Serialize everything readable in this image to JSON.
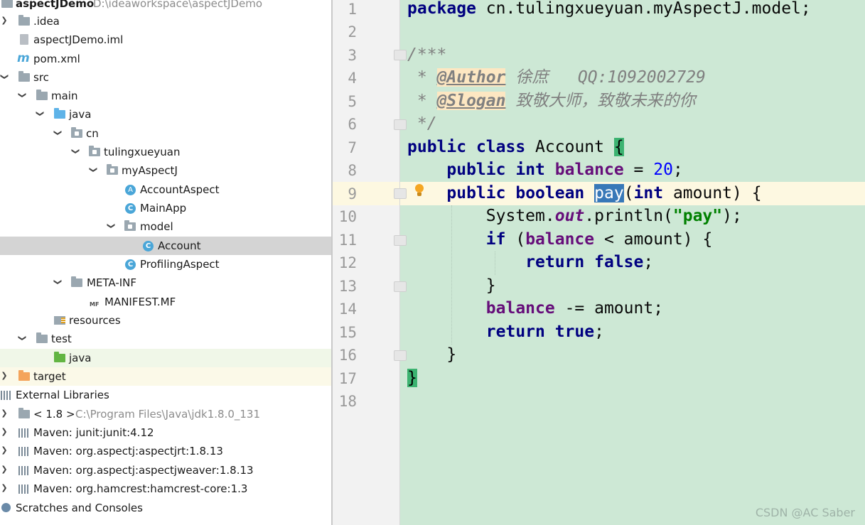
{
  "project": {
    "root_name": "aspectJDemo",
    "root_path": "D:\\ideaworkspace\\aspectJDemo",
    "items": [
      {
        "label": ".idea"
      },
      {
        "label": "aspectJDemo.iml"
      },
      {
        "label": "pom.xml"
      },
      {
        "label": "src"
      },
      {
        "label": "main"
      },
      {
        "label": "java"
      },
      {
        "label": "cn"
      },
      {
        "label": "tulingxueyuan"
      },
      {
        "label": "myAspectJ"
      },
      {
        "label": "AccountAspect"
      },
      {
        "label": "MainApp"
      },
      {
        "label": "model"
      },
      {
        "label": "Account"
      },
      {
        "label": "ProfilingAspect"
      },
      {
        "label": "META-INF"
      },
      {
        "label": "MANIFEST.MF"
      },
      {
        "label": "resources"
      },
      {
        "label": "test"
      },
      {
        "label": "java"
      },
      {
        "label": "target"
      },
      {
        "label": "External Libraries"
      },
      {
        "label": "< 1.8 >",
        "detail": "C:\\Program Files\\Java\\jdk1.8.0_131"
      },
      {
        "label": "Maven: junit:junit:4.12"
      },
      {
        "label": "Maven: org.aspectj:aspectjrt:1.8.13"
      },
      {
        "label": "Maven: org.aspectj:aspectjweaver:1.8.13"
      },
      {
        "label": "Maven: org.hamcrest:hamcrest-core:1.3"
      },
      {
        "label": "Scratches and Consoles"
      }
    ],
    "icon_letters": {
      "class": "C",
      "aspect": "A",
      "maven": "m",
      "manifest": "MF"
    }
  },
  "editor": {
    "line_numbers": [
      "1",
      "2",
      "3",
      "4",
      "5",
      "6",
      "7",
      "8",
      "9",
      "10",
      "11",
      "12",
      "13",
      "14",
      "15",
      "16",
      "17",
      "18"
    ],
    "tokens": {
      "package": "package",
      "package_name": " cn.tulingxueyuan.myAspectJ.model;",
      "doc_open": "/***",
      "doc_star": " * ",
      "author_tag": "@Author",
      "author_text": " 徐庶   QQ:1092002729",
      "slogan_tag": "@Slogan",
      "slogan_text": " 致敬大师，致敬未来的你",
      "doc_close": " */",
      "public": "public",
      "class": "class",
      "class_name": " Account ",
      "open_brace": "{",
      "int": "int",
      "balance": "balance",
      "eq_20": " = ",
      "twenty": "20",
      "semi": ";",
      "boolean": "boolean",
      "pay": "pay",
      "paren_open": "(",
      "amount_param": " amount) {",
      "system": "System.",
      "out": "out",
      "println": ".println(",
      "pay_str": "\"pay\"",
      "println_end": ");",
      "if": "if",
      "if_open": " (",
      "if_cond": " < amount) {",
      "return": "return",
      "false": "false",
      "close_brace": "}",
      "minus_eq": " -= amount;",
      "true": "true"
    }
  },
  "watermark": "CSDN @AC Saber",
  "colors": {
    "editor_bg": "#cde8d5",
    "keyword": "#000080",
    "field": "#660e7a",
    "string": "#008000",
    "number": "#0000ff",
    "comment": "#808080"
  }
}
